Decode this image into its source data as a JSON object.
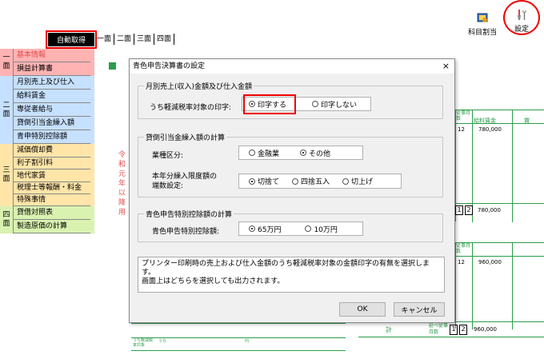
{
  "toolbar": {
    "subject_assign_label": "科目割当",
    "settings_label": "設定"
  },
  "mode_button": "自動取得",
  "tabs": [
    "一面",
    "二面",
    "三面",
    "四面"
  ],
  "nav": {
    "group1_num": "一\n面",
    "group1": [
      "基本情報",
      "損益計算書"
    ],
    "group2_num": "二\n面",
    "group2": [
      "月別売上及び仕入",
      "給料賃金",
      "専従者給与",
      "貸倒引当金繰入額",
      "青申特別控除額"
    ],
    "group3_num": "三\n面",
    "group3": [
      "減価償却費",
      "利子割引料",
      "地代家賃",
      "税理士等報酬・料金",
      "特殊事情"
    ],
    "group4_num": "四\n面",
    "group4": [
      "貸借対照表",
      "製造原価の計算"
    ]
  },
  "colors": {
    "nav1_bg": "#ffb3b3",
    "nav2_bg": "#c6e0ff",
    "nav3_bg": "#ffe5a8",
    "nav4_bg": "#d9f2b0",
    "form_green": "#2a9d4a",
    "highlight_red": "#e00000"
  },
  "form": {
    "side_text": "令和元年以降用",
    "row1_num": "12",
    "row1_amount": "780,000",
    "row2_box1": "1",
    "row2_box2": "2",
    "row2_amount": "780,000",
    "row3_num": "12",
    "row3_amount": "960,000",
    "row4_box1": "1",
    "row4_box2": "2",
    "row4_amount": "960,000",
    "col_head1": "給料賃金",
    "col_head2": "賞",
    "col_small": "従事月数",
    "row_total": "計",
    "row_small": "延べ従事月数",
    "bottom_label": "うち",
    "bottom_label2": "円",
    "bottom_small": "うち軽減税率対象"
  },
  "dialog": {
    "title": "青色申告決算書の設定",
    "close": "×",
    "g1_label": "月別売上(収入)金額及び仕入金額",
    "g1_field": "うち軽減税率対象の印字:",
    "g1_opt1": "印字する",
    "g1_opt2": "印字しない",
    "g2_label": "貸倒引当金繰入額の計算",
    "g2_field1": "業種区分:",
    "g2_f1_opt1": "金融業",
    "g2_f1_opt2": "その他",
    "g2_field2a": "本年分繰入限度額の",
    "g2_field2b": "端数設定:",
    "g2_f2_opt1": "切捨て",
    "g2_f2_opt2": "四捨五入",
    "g2_f2_opt3": "切上げ",
    "g3_label": "青色申告特別控除額の計算",
    "g3_field": "青色申告特別控除額:",
    "g3_opt1": "65万円",
    "g3_opt2": "10万円",
    "desc1": "プリンター印刷時の売上および仕入金額のうち軽減税率対象の金額印字の有無を選択します。",
    "desc2": "画面上はどちらを選択しても出力されます。",
    "ok": "OK",
    "cancel": "キャンセル"
  }
}
